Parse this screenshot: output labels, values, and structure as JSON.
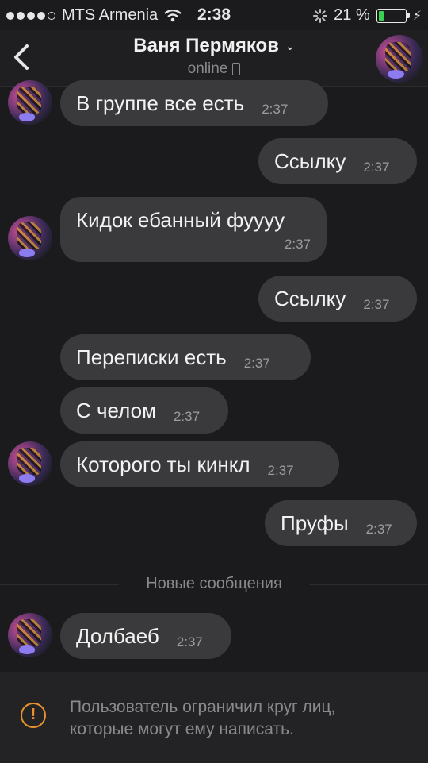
{
  "status_bar": {
    "carrier": "MTS Armenia",
    "time": "2:38",
    "battery_percent_label": "21 %",
    "battery_level": 0.21,
    "battery_color": "#39d353"
  },
  "nav": {
    "contact_name": "Ваня Пермяков",
    "status": "online",
    "icons": [
      "back-chevron-icon",
      "chevron-down-icon",
      "phone-icon",
      "avatar"
    ]
  },
  "messages": [
    {
      "side": "in",
      "text": "В группе все есть",
      "time": "2:37"
    },
    {
      "side": "out",
      "text": "Ссылку",
      "time": "2:37"
    },
    {
      "side": "in",
      "text": "Кидок ебанный фуууу",
      "time": "2:37"
    },
    {
      "side": "out",
      "text": "Ссылку",
      "time": "2:37"
    },
    {
      "side": "in",
      "text": "Переписки есть",
      "time": "2:37"
    },
    {
      "side": "in",
      "text": "С челом",
      "time": "2:37"
    },
    {
      "side": "in",
      "text": "Которого ты кинкл",
      "time": "2:37"
    },
    {
      "side": "out",
      "text": "Пруфы",
      "time": "2:37"
    },
    {
      "side": "in",
      "text": "Долбаеб",
      "time": "2:37"
    }
  ],
  "divider_label": "Новые сообщения",
  "footer": {
    "notice": "Пользователь ограничил круг лиц, которые могут ему написать.",
    "icon": "warning-icon",
    "accent": "#e8912d"
  },
  "colors": {
    "background": "#1b1b1d",
    "bubble": "#3a3a3c"
  }
}
